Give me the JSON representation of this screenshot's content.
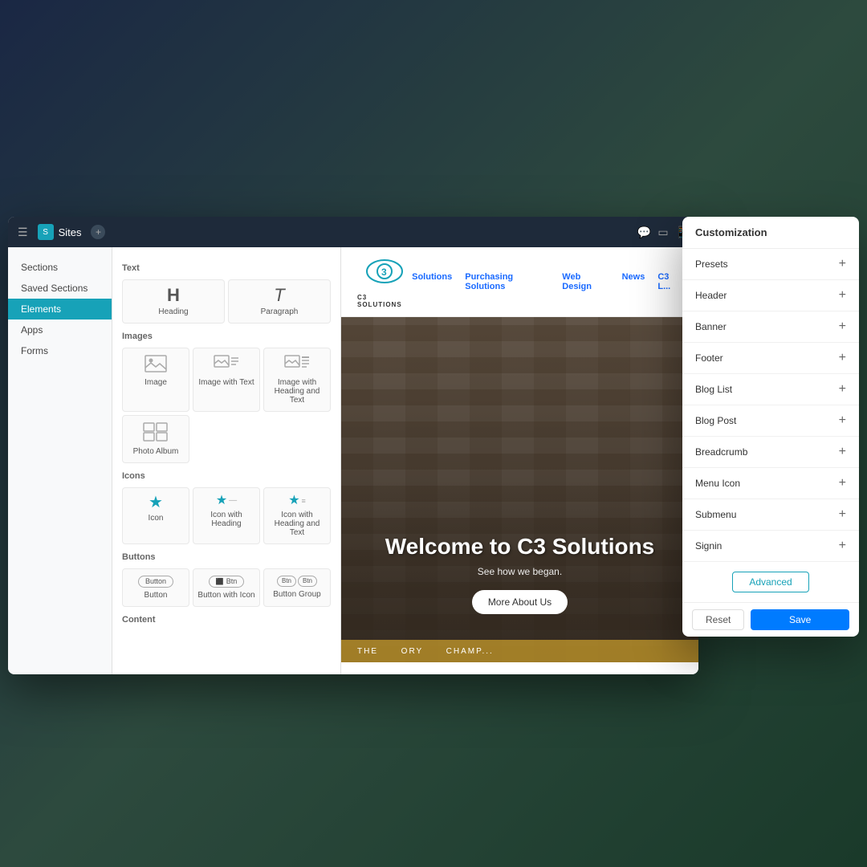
{
  "topbar": {
    "app_name": "Sites",
    "add_label": "+",
    "view_desktop": "□",
    "view_tablet": "◻",
    "view_mobile": "□"
  },
  "sidebar": {
    "items": [
      {
        "label": "Sections",
        "active": false
      },
      {
        "label": "Saved Sections",
        "active": false
      },
      {
        "label": "Elements",
        "active": true
      },
      {
        "label": "Apps",
        "active": false
      },
      {
        "label": "Forms",
        "active": false
      }
    ]
  },
  "elements_panel": {
    "sections": [
      {
        "title": "Text",
        "items": [
          {
            "icon": "H",
            "label": "Heading",
            "type": "text"
          },
          {
            "icon": "T",
            "label": "Paragraph",
            "type": "text"
          }
        ]
      },
      {
        "title": "Images",
        "items": [
          {
            "icon": "img",
            "label": "Image",
            "type": "image"
          },
          {
            "icon": "img-text",
            "label": "Image with Text",
            "type": "image"
          },
          {
            "icon": "img-heading-text",
            "label": "Image with Heading and Text",
            "type": "image"
          },
          {
            "icon": "album",
            "label": "Photo Album",
            "type": "image"
          }
        ]
      },
      {
        "title": "Icons",
        "items": [
          {
            "icon": "★",
            "label": "Icon",
            "type": "icon"
          },
          {
            "icon": "★—",
            "label": "Icon with Heading",
            "type": "icon"
          },
          {
            "icon": "★≡",
            "label": "Icon with Heading and Text",
            "type": "icon"
          }
        ]
      },
      {
        "title": "Buttons",
        "items": [
          {
            "icon": "btn",
            "label": "Button",
            "type": "button"
          },
          {
            "icon": "btn-icon",
            "label": "Button with Icon",
            "type": "button"
          },
          {
            "icon": "btn-group",
            "label": "Button Group",
            "type": "button"
          }
        ]
      },
      {
        "title": "Content",
        "items": []
      }
    ]
  },
  "preview": {
    "logo_text": "C3 SOLUTIONS",
    "nav_links": [
      "Solutions",
      "Purchasing Solutions",
      "Web Design",
      "News",
      "C3 L..."
    ],
    "hero_title": "Welcome to C3 Solutions",
    "hero_subtitle": "See how we began.",
    "hero_cta": "More About Us",
    "ticker_text": "THE    ORY    CHAMP..."
  },
  "customization": {
    "title": "Customization",
    "rows": [
      {
        "label": "Presets"
      },
      {
        "label": "Header"
      },
      {
        "label": "Banner"
      },
      {
        "label": "Footer"
      },
      {
        "label": "Blog List"
      },
      {
        "label": "Blog Post"
      },
      {
        "label": "Breadcrumb"
      },
      {
        "label": "Menu Icon"
      },
      {
        "label": "Submenu"
      },
      {
        "label": "Signin"
      }
    ],
    "advanced_label": "Advanced",
    "reset_label": "Reset",
    "save_label": "Save"
  }
}
